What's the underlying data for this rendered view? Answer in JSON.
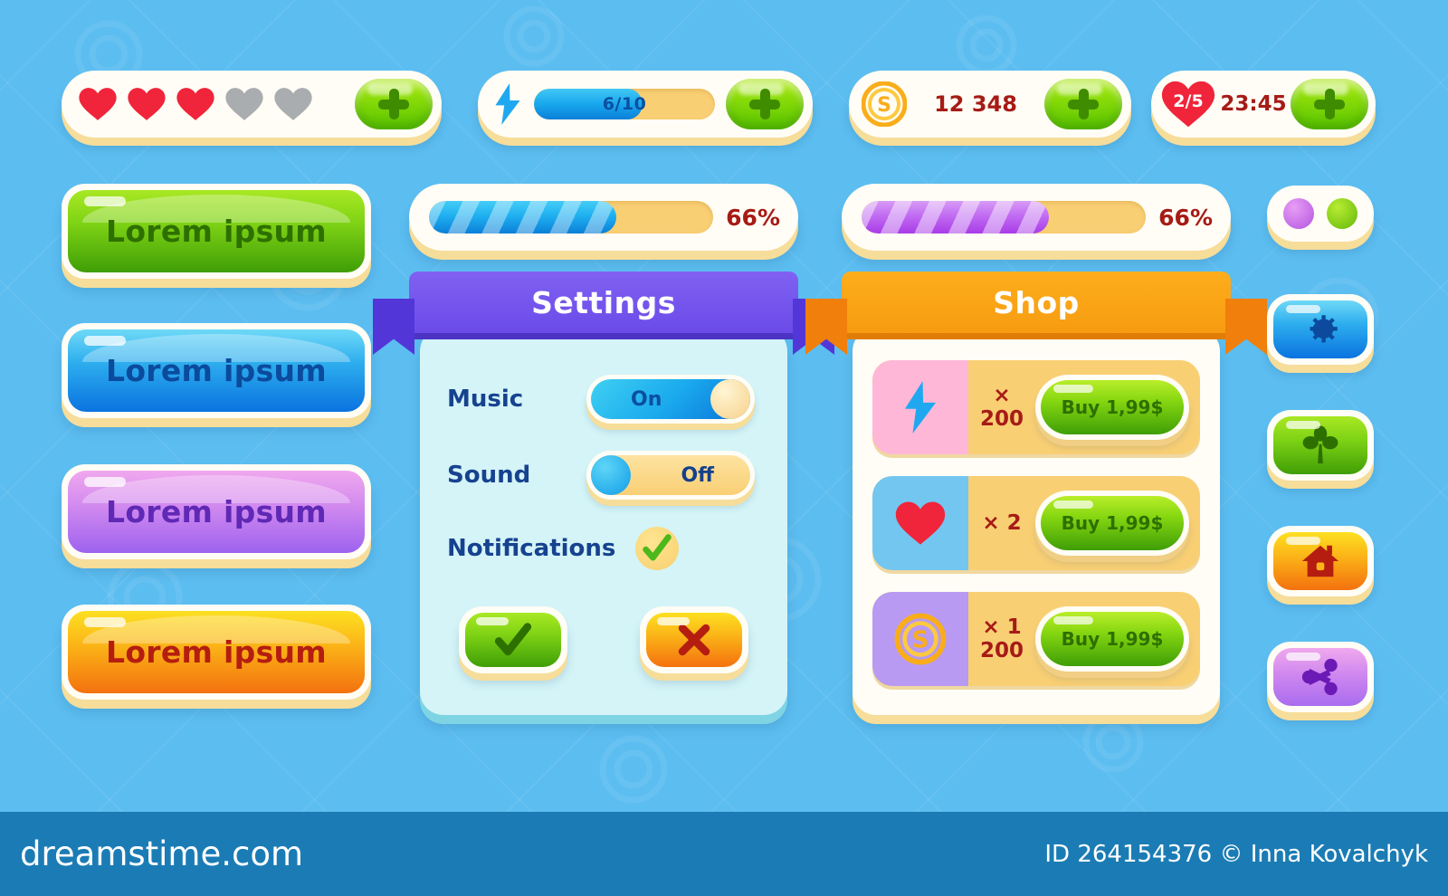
{
  "background": {
    "color": "#5cbdf0"
  },
  "hud": {
    "hearts_bar": {
      "name": "lives-hearts",
      "hearts_filled": 3,
      "hearts_empty": 2,
      "filled_color": "#f0243a",
      "empty_color": "#a9adaf",
      "plus_label": "+"
    },
    "energy_bar": {
      "icon": "lightning-bolt-icon",
      "value_label": "6/10",
      "fill_percent": 60,
      "fill_color": "#18a7ee",
      "track_color": "#f9cf74",
      "plus_label": "+"
    },
    "coin_bar": {
      "icon": "coin-icon",
      "coin_letter": "S",
      "amount": "12 348",
      "amount_color": "#a61b16",
      "plus_label": "+"
    },
    "lives_timer_bar": {
      "icon": "heart-badge-icon",
      "lives_label": "2/5",
      "timer_label": "23:45",
      "timer_color": "#a61b16",
      "plus_label": "+"
    }
  },
  "buttons": [
    {
      "id": "btn-green",
      "label": "Lorem ipsum",
      "color": "#7fd315",
      "text_color": "#2e7000"
    },
    {
      "id": "btn-blue",
      "label": "Lorem ipsum",
      "color": "#2eaeee",
      "text_color": "#0b4a9c"
    },
    {
      "id": "btn-purple",
      "label": "Lorem ipsum",
      "color": "#d088ef",
      "text_color": "#5f28b5"
    },
    {
      "id": "btn-orange",
      "label": "Lorem ipsum",
      "color": "#fbb417",
      "text_color": "#b51d10"
    }
  ],
  "progress_bars": [
    {
      "id": "progress-blue",
      "percent_label": "66%",
      "percent": 66,
      "fill_color": "#1fb0f0"
    },
    {
      "id": "progress-purple",
      "percent_label": "66%",
      "percent": 66,
      "fill_color": "#c16cf2"
    }
  ],
  "settings_panel": {
    "title": "Settings",
    "ribbon_color": "#6b4be8",
    "body_color": "#d4f4f7",
    "rows": [
      {
        "label": "Music",
        "state": "on",
        "state_label": "On"
      },
      {
        "label": "Sound",
        "state": "off",
        "state_label": "Off"
      }
    ],
    "notifications": {
      "label": "Notifications",
      "icon": "check-circle-icon",
      "checked": true
    },
    "actions": [
      {
        "id": "btn-confirm",
        "icon": "check-icon",
        "color": "#7fd315"
      },
      {
        "id": "btn-cancel",
        "icon": "cross-icon",
        "color": "#fbb417"
      }
    ]
  },
  "shop_panel": {
    "title": "Shop",
    "ribbon_color": "#f79b10",
    "rows": [
      {
        "icon": "lightning-bolt-icon",
        "icon_bg": "#ffb7d8",
        "quantity": "× 200",
        "buy_label": "Buy 1,99$"
      },
      {
        "icon": "heart-icon",
        "icon_bg": "#73c6f0",
        "quantity": "× 2",
        "buy_label": "Buy 1,99$"
      },
      {
        "icon": "coin-icon",
        "icon_bg": "#b89af2",
        "quantity": "× 1 200",
        "buy_label": "Buy 1,99$"
      }
    ]
  },
  "icon_column": {
    "dots": [
      {
        "name": "dot-purple",
        "color": "#b455e0"
      },
      {
        "name": "dot-green",
        "color": "#64b80a"
      }
    ],
    "buttons": [
      {
        "id": "icon-gear",
        "icon": "gear-icon",
        "color": "#2eaeee"
      },
      {
        "id": "icon-clover",
        "icon": "clover-icon",
        "color": "#7fd315"
      },
      {
        "id": "icon-home",
        "icon": "home-icon",
        "color": "#fbb417"
      },
      {
        "id": "icon-share",
        "icon": "share-icon",
        "color": "#d088ef"
      }
    ]
  },
  "footer": {
    "logo": "dreamstime.com",
    "credit": "ID 264154376 © Inna Kovalchyk",
    "band_color": "#1b7cb5"
  }
}
